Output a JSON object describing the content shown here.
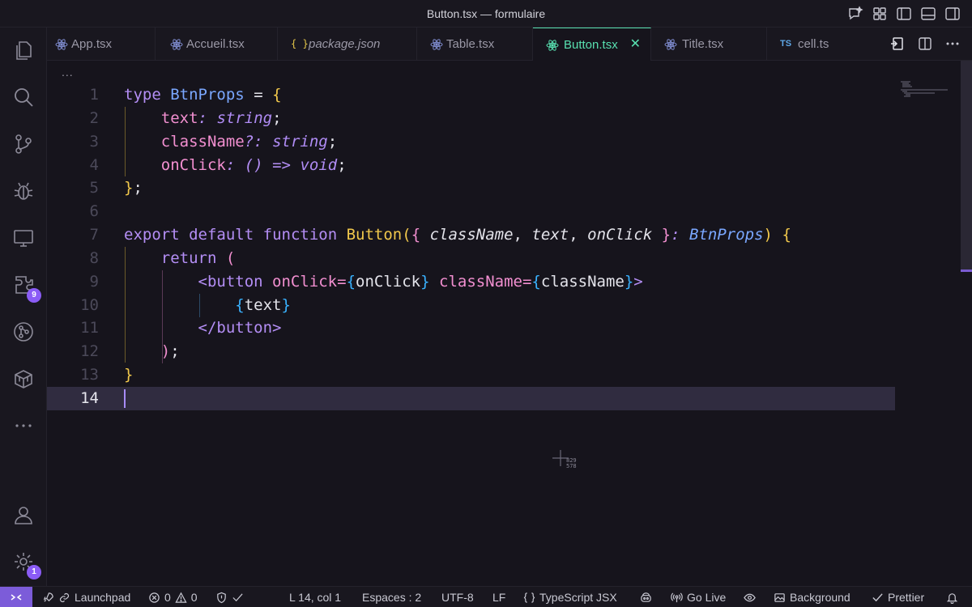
{
  "window": {
    "title": "Button.tsx — formulaire"
  },
  "activity_bar": {
    "items": [
      {
        "name": "explorer-icon"
      },
      {
        "name": "search-icon"
      },
      {
        "name": "source-control-icon"
      },
      {
        "name": "debug-icon"
      },
      {
        "name": "remote-explorer-icon"
      },
      {
        "name": "extensions-icon",
        "badge": "9"
      },
      {
        "name": "git-graph-icon"
      },
      {
        "name": "packages-icon"
      },
      {
        "name": "more-icon"
      }
    ],
    "account_icon": "account-icon",
    "settings_badge": "1"
  },
  "tabs": [
    {
      "label": "App.tsx",
      "icon": "react-icon"
    },
    {
      "label": "Accueil.tsx",
      "icon": "react-icon"
    },
    {
      "label": "package.json",
      "icon": "json-icon",
      "italic": true
    },
    {
      "label": "Table.tsx",
      "icon": "react-icon"
    },
    {
      "label": "Button.tsx",
      "icon": "react-icon",
      "active": true
    },
    {
      "label": "Title.tsx",
      "icon": "react-icon"
    },
    {
      "label": "cell.ts",
      "icon": "ts-icon"
    }
  ],
  "ts_icon_text": "TS",
  "json_icon_text": "{ }",
  "breadcrumb": "...",
  "editor": {
    "line_numbers": [
      "1",
      "2",
      "3",
      "4",
      "5",
      "6",
      "7",
      "8",
      "9",
      "10",
      "11",
      "12",
      "13",
      "14"
    ],
    "current_line": "14",
    "code": {
      "l1": [
        "type",
        "BtnProps",
        "=",
        "{"
      ],
      "l2": [
        "text",
        ":",
        "string",
        ";"
      ],
      "l3": [
        "className",
        "?:",
        "string",
        ";"
      ],
      "l4": [
        "onClick",
        ":",
        "()",
        "=>",
        "void",
        ";"
      ],
      "l5": [
        "}",
        ";"
      ],
      "l7": [
        "export",
        "default",
        "function",
        "Button",
        "(",
        "{",
        "className",
        ",",
        "text",
        ",",
        "onClick",
        "}",
        ":",
        "BtnProps",
        ")",
        "{"
      ],
      "l8": [
        "return",
        "("
      ],
      "l9": [
        "<button",
        "onClick",
        "=",
        "{",
        "onClick",
        "}",
        "className",
        "=",
        "{",
        "className",
        "}",
        ">"
      ],
      "l10": [
        "{",
        "text",
        "}"
      ],
      "l11": [
        "</button>"
      ],
      "l12": [
        ")",
        ";"
      ],
      "l13": [
        "}"
      ]
    }
  },
  "pointer": {
    "coord": "829\n578"
  },
  "status_bar": {
    "launchpad": "Launchpad",
    "errors": "0",
    "warnings": "0",
    "position": "L 14, col 1",
    "indent": "Espaces : 2",
    "encoding": "UTF-8",
    "eol": "LF",
    "language": "TypeScript JSX",
    "go_live": "Go Live",
    "background": "Background",
    "prettier": "Prettier"
  },
  "colors": {
    "accent": "#58e0b0",
    "purple": "#7c5cd9",
    "badge": "#8b5cf6"
  }
}
